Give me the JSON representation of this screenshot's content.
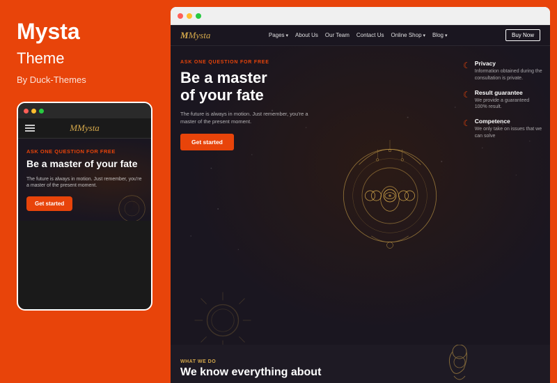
{
  "left": {
    "brand_name": "Mysta",
    "brand_sub": "Theme",
    "brand_by": "By Duck-Themes",
    "mobile": {
      "ask": "ASK ONE QUESTION FOR FREE",
      "headline": "Be a master of your fate",
      "body": "The future is always in motion. Just remember, you're a master of the present moment.",
      "cta": "Get started",
      "logo": "Mysta"
    }
  },
  "right": {
    "nav": {
      "logo": "Mysta",
      "links": [
        {
          "label": "Pages",
          "arrow": true
        },
        {
          "label": "About Us",
          "arrow": false
        },
        {
          "label": "Our Team",
          "arrow": false
        },
        {
          "label": "Contact Us",
          "arrow": false
        },
        {
          "label": "Online Shop",
          "arrow": true
        },
        {
          "label": "Blog",
          "arrow": true
        }
      ],
      "cta": "Buy Now"
    },
    "hero": {
      "ask": "ASK ONE QUESTION FOR FREE",
      "headline_line1": "Be a master",
      "headline_line2": "of your fate",
      "body": "The future is always in motion. Just remember, you're a master of the present moment.",
      "cta": "Get started"
    },
    "features": [
      {
        "icon": "☾",
        "title": "Privacy",
        "desc": "Information obtained during the consultation is private."
      },
      {
        "icon": "☾",
        "title": "Result guarantee",
        "desc": "We provide a guaranteed 100% result."
      },
      {
        "icon": "☾",
        "title": "Competence",
        "desc": "We only take on issues that we can solve"
      }
    ],
    "bottom": {
      "what": "WHAT WE DO",
      "headline": "We know everything about"
    }
  },
  "colors": {
    "orange": "#e8440a",
    "dark_bg": "#1a1620",
    "gold": "#d4a84b",
    "white": "#ffffff"
  }
}
